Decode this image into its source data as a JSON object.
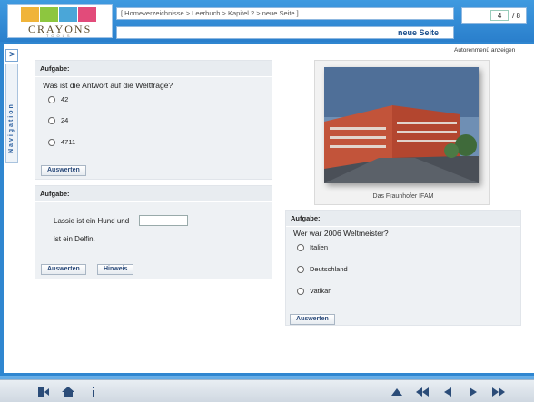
{
  "header": {
    "breadcrumb": "[ Homeverzeichnisse > Leerbuch > Kapitel 2 > neue Seite ]",
    "page_title": "neue Seite",
    "page_current": "4",
    "page_total": "/ 8",
    "logo_text": "CRAYONS",
    "logo_subtext": "TOOLS"
  },
  "sidebar": {
    "toggle": ">",
    "nav_label": "Navigation"
  },
  "main": {
    "author_menu": "Autorenmenü anzeigen",
    "task1": {
      "title": "Aufgabe:",
      "question": "Was ist die Antwort auf die Weltfrage?",
      "options": [
        "42",
        "24",
        "4711"
      ],
      "evaluate": "Auswerten"
    },
    "task2": {
      "title": "Aufgabe:",
      "text_before": "Lassie ist ein Hund und",
      "text_after": "ist ein Delfin.",
      "evaluate": "Auswerten",
      "hint": "Hinweis"
    },
    "image": {
      "caption": "Das Fraunhofer IFAM"
    },
    "task3": {
      "title": "Aufgabe:",
      "question": "Wer war 2006 Weltmeister?",
      "options": [
        "Italien",
        "Deutschland",
        "Vatikan"
      ],
      "evaluate": "Auswerten"
    }
  },
  "footer": {
    "icons": [
      "exit-icon",
      "home-icon",
      "info-icon",
      "up-icon",
      "first-icon",
      "prev-icon",
      "next-icon",
      "last-icon"
    ]
  },
  "colors": {
    "accent": "#2f86d0",
    "panel": "#eef1f4",
    "title_text": "#1c4f8c"
  }
}
